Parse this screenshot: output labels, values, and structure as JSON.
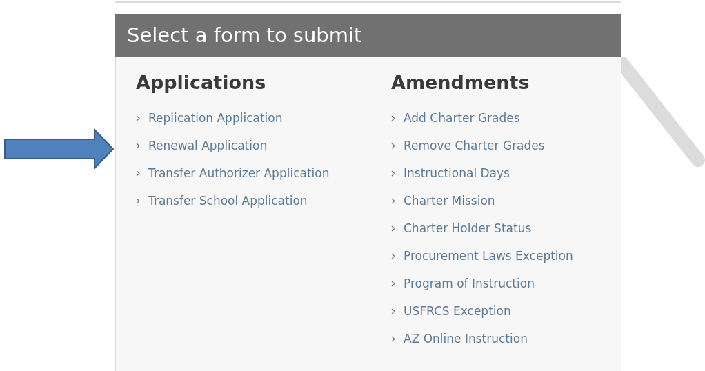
{
  "panel": {
    "title": "Select a form to submit"
  },
  "columns": [
    {
      "heading": "Applications",
      "items": [
        {
          "label": "Replication Application"
        },
        {
          "label": "Renewal Application"
        },
        {
          "label": "Transfer Authorizer Application"
        },
        {
          "label": "Transfer School Application"
        }
      ]
    },
    {
      "heading": "Amendments",
      "items": [
        {
          "label": "Add Charter Grades"
        },
        {
          "label": "Remove Charter Grades"
        },
        {
          "label": "Instructional Days"
        },
        {
          "label": "Charter Mission"
        },
        {
          "label": "Charter Holder Status"
        },
        {
          "label": "Procurement Laws Exception"
        },
        {
          "label": "Program of Instruction"
        },
        {
          "label": "USFRCS Exception"
        },
        {
          "label": "AZ Online Instruction"
        }
      ]
    }
  ]
}
